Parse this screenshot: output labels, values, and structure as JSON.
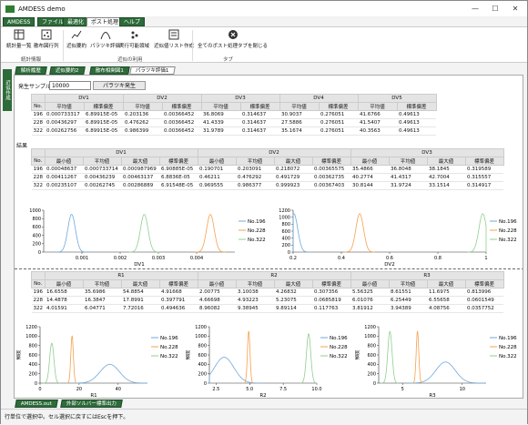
{
  "window": {
    "title": "AMDESS demo",
    "minimize": "—",
    "maximize": "☐",
    "close": "✕"
  },
  "menu": [
    "AMDESS",
    "ファイル",
    "最適化",
    "ポスト処理",
    "ヘルプ"
  ],
  "ribbon": {
    "buttons": [
      "統計量一覧",
      "散布図行列",
      "近似要約",
      "パラツキ評価",
      "実行可能領域",
      "近似値リスト作成",
      "全てのポスト処理タブを閉じる"
    ],
    "groups": [
      "統計情報",
      "近似の利用",
      "タブ"
    ]
  },
  "side_tab": "近似作成",
  "tabs": [
    "解析履歴",
    "近似要約2",
    "散布相関図1",
    "パラツキ評価1"
  ],
  "sample": {
    "label": "発生サンプル数",
    "value": "10000",
    "button": "パラツキ発生"
  },
  "table1": {
    "headers": [
      "DV1",
      "DV2",
      "DV3",
      "DV4",
      "DV5"
    ],
    "sub": [
      "平均値",
      "標準偏差"
    ],
    "col_no": "No.",
    "rows": [
      [
        "196",
        "0.000733317",
        "6.89915E-05",
        "0.203136",
        "0.00366452",
        "36.8069",
        "0.314637",
        "30.9037",
        "0.276051",
        "41.6766",
        "0.49613"
      ],
      [
        "228",
        "0.00436297",
        "6.89915E-05",
        "0.476262",
        "0.00366452",
        "41.4339",
        "0.314637",
        "27.5886",
        "0.276051",
        "41.5407",
        "0.49613"
      ],
      [
        "322",
        "0.00262756",
        "6.89915E-05",
        "0.986399",
        "0.00366452",
        "31.9789",
        "0.314637",
        "35.1674",
        "0.276051",
        "40.3563",
        "0.49613"
      ]
    ]
  },
  "result_label": "結果",
  "table2": {
    "headers": [
      "DV1",
      "DV2",
      "DV3"
    ],
    "sub": [
      "最小値",
      "平均値",
      "最大値",
      "標準偏差"
    ],
    "col_no": "No.",
    "rows": [
      [
        "196",
        "0.00048637",
        "0.000733714",
        "0.000987969",
        "6.90885E-05",
        "0.190701",
        "0.203091",
        "0.218072",
        "0.00365575",
        "35.4866",
        "36.8048",
        "38.1845",
        "0.319589"
      ],
      [
        "228",
        "0.00411267",
        "0.00436239",
        "0.00463137",
        "6.8836E-05",
        "0.46211",
        "0.476292",
        "0.491729",
        "0.00362735",
        "40.2774",
        "41.4317",
        "42.7004",
        "0.315557"
      ],
      [
        "322",
        "0.00235107",
        "0.00262745",
        "0.00286889",
        "6.91548E-05",
        "0.969555",
        "0.986377",
        "0.999923",
        "0.00367403",
        "30.8144",
        "31.9724",
        "33.1514",
        "0.314917"
      ]
    ]
  },
  "table3": {
    "headers": [
      "R1",
      "R2",
      "R3"
    ],
    "sub": [
      "最小値",
      "平均値",
      "最大値",
      "標準偏差"
    ],
    "col_no": "No.",
    "rows": [
      [
        "196",
        "16.6558",
        "35.6986",
        "54.8854",
        "4.91668",
        "2.00775",
        "3.10038",
        "4.26832",
        "0.307356",
        "5.56325",
        "8.61551",
        "11.6975",
        "0.813996"
      ],
      [
        "228",
        "14.4878",
        "16.3847",
        "17.8991",
        "0.397791",
        "4.66698",
        "4.93223",
        "5.23075",
        "0.0685819",
        "6.01076",
        "6.25449",
        "6.55658",
        "0.0601549"
      ],
      [
        "322",
        "4.01591",
        "6.04771",
        "7.72016",
        "0.494636",
        "8.96082",
        "9.38945",
        "9.89114",
        "0.117763",
        "3.81912",
        "3.94389",
        "4.08756",
        "0.0357752"
      ]
    ]
  },
  "legend": [
    "No.196",
    "No.228",
    "No.322"
  ],
  "series_colors": [
    "#6fa8dc",
    "#f6a04d",
    "#8fcf8f"
  ],
  "chart_data": [
    {
      "type": "area",
      "title": "",
      "xlabel": "DV1",
      "ylabel": "",
      "xlim": [
        0,
        0.005
      ],
      "ylim": [
        0,
        1000
      ],
      "xticks": [
        "0.001",
        "0.002",
        "0.003",
        "0.004"
      ],
      "yticks": [
        "0",
        "200",
        "400",
        "600",
        "800",
        "1000"
      ],
      "series": [
        {
          "name": "No.196",
          "peak_x": 0.00073,
          "peak_y": 900
        },
        {
          "name": "No.228",
          "peak_x": 0.00436,
          "peak_y": 900
        },
        {
          "name": "No.322",
          "peak_x": 0.00263,
          "peak_y": 900
        }
      ]
    },
    {
      "type": "area",
      "title": "",
      "xlabel": "DV2",
      "ylabel": "",
      "xlim": [
        0.2,
        1
      ],
      "ylim": [
        0,
        1200
      ],
      "xticks": [
        "0.2",
        "0.4",
        "0.6",
        "0.8",
        "1"
      ],
      "yticks": [
        "0",
        "200",
        "400",
        "600",
        "800",
        "1000",
        "1200"
      ],
      "series": [
        {
          "name": "No.196",
          "peak_x": 0.203,
          "peak_y": 1100
        },
        {
          "name": "No.228",
          "peak_x": 0.476,
          "peak_y": 1100
        },
        {
          "name": "No.322",
          "peak_x": 0.986,
          "peak_y": 1100
        }
      ]
    },
    {
      "type": "area",
      "title": "",
      "xlabel": "R1",
      "ylabel": "頻度",
      "xlim": [
        0,
        55
      ],
      "ylim": [
        0,
        1200
      ],
      "xticks": [
        "0",
        "20",
        "40"
      ],
      "yticks": [
        "0",
        "200",
        "400",
        "600",
        "800",
        "1000",
        "1200"
      ],
      "series": [
        {
          "name": "No.196",
          "peak_x": 35.7,
          "peak_y": 400
        },
        {
          "name": "No.228",
          "peak_x": 16.4,
          "peak_y": 1000
        },
        {
          "name": "No.322",
          "peak_x": 6.0,
          "peak_y": 850
        }
      ]
    },
    {
      "type": "area",
      "title": "",
      "xlabel": "R2",
      "ylabel": "頻度",
      "xlim": [
        2,
        10
      ],
      "ylim": [
        0,
        1200
      ],
      "xticks": [
        "2.5",
        "5.0",
        "7.5",
        "10.0"
      ],
      "yticks": [
        "0",
        "200",
        "400",
        "600",
        "800",
        "1000",
        "1200"
      ],
      "series": [
        {
          "name": "No.196",
          "peak_x": 3.1,
          "peak_y": 550
        },
        {
          "name": "No.228",
          "peak_x": 4.93,
          "peak_y": 1100
        },
        {
          "name": "No.322",
          "peak_x": 9.39,
          "peak_y": 1050
        }
      ]
    },
    {
      "type": "area",
      "title": "",
      "xlabel": "R3",
      "ylabel": "頻度",
      "xlim": [
        3,
        12
      ],
      "ylim": [
        0,
        1200
      ],
      "xticks": [
        "5",
        "10"
      ],
      "yticks": [
        "0",
        "200",
        "400",
        "600",
        "800",
        "1000",
        "1200"
      ],
      "series": [
        {
          "name": "No.196",
          "peak_x": 8.6,
          "peak_y": 450
        },
        {
          "name": "No.228",
          "peak_x": 6.25,
          "peak_y": 1100
        },
        {
          "name": "No.322",
          "peak_x": 3.94,
          "peak_y": 1100
        }
      ]
    }
  ],
  "bottom_tabs": [
    "AMDESS.out",
    "外部ソルバー標準出力"
  ],
  "status": "行単位で選択中。セル選択に戻すにはEscを押下。"
}
